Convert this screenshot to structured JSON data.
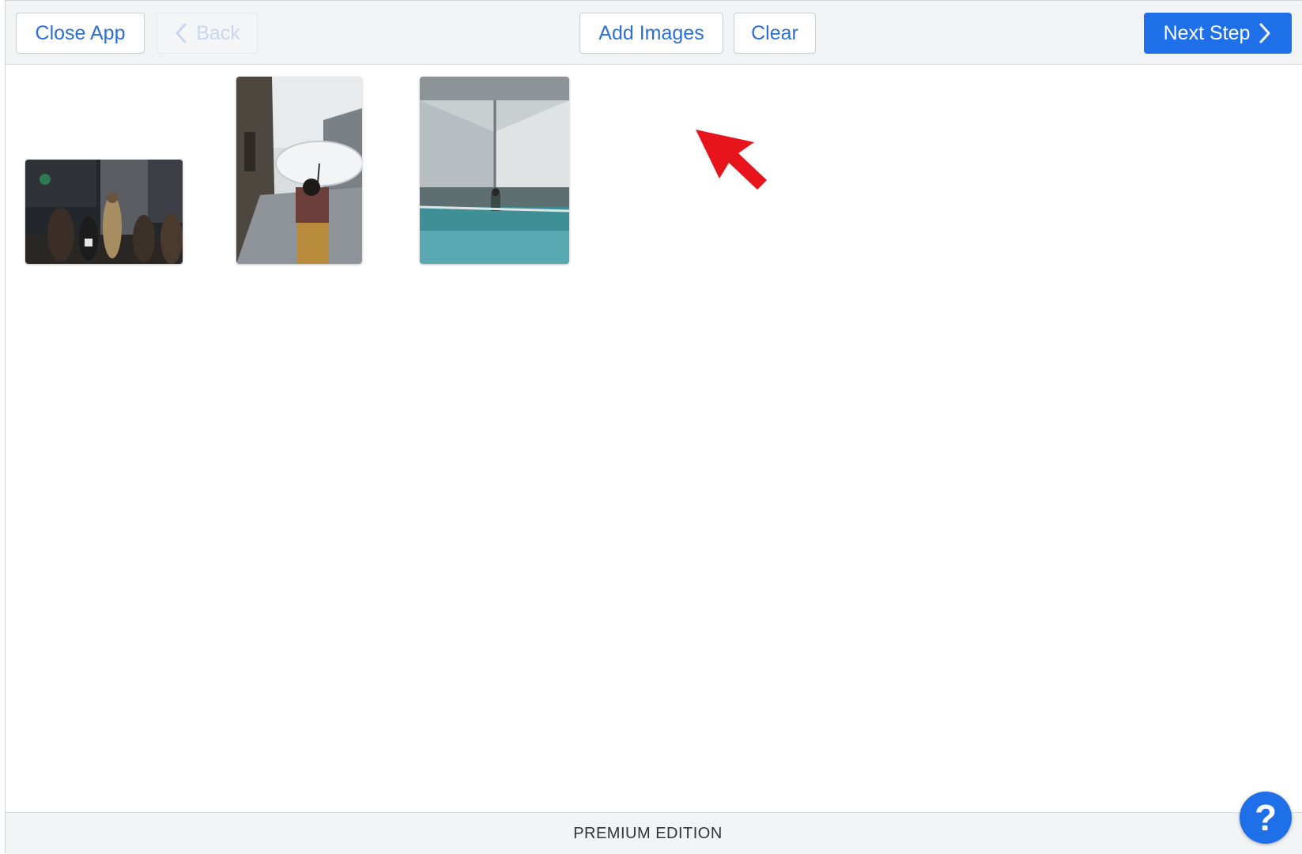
{
  "toolbar": {
    "close_app_label": "Close App",
    "back_label": "Back",
    "add_images_label": "Add Images",
    "clear_label": "Clear",
    "next_step_label": "Next Step"
  },
  "gallery": {
    "images": [
      {
        "icon": "photo-thumbnail",
        "subject": "crowd-indoors"
      },
      {
        "icon": "photo-thumbnail",
        "subject": "woman-with-umbrella-street"
      },
      {
        "icon": "photo-thumbnail",
        "subject": "person-at-pool-under-roof"
      }
    ]
  },
  "footer": {
    "edition_label": "PREMIUM EDITION"
  },
  "help": {
    "label": "?"
  },
  "colors": {
    "accent": "#1f6fe8",
    "link_text": "#2b6fd6",
    "toolbar_bg": "#f2f3f5",
    "annotation_arrow": "#e8141c"
  }
}
